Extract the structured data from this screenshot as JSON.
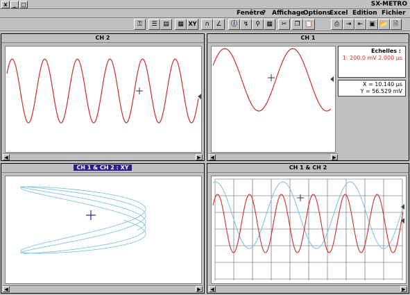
{
  "app": {
    "title": "SX-METRO",
    "sys_close": "x",
    "sys_min": "_",
    "sys_max": "□"
  },
  "menu": {
    "items": [
      "Fichier",
      "Edition",
      "Excel",
      "Options",
      "Affichage",
      "Fenêtre",
      "?"
    ]
  },
  "toolbar": {
    "xy_label": "XY"
  },
  "panels": {
    "ch2": {
      "title": "CH 2"
    },
    "ch1": {
      "title": "CH 1",
      "scales_title": "Echelles :",
      "scales_value": "1:  200.0 mV   2.000 µs",
      "x_readout": "X  = 10.140 µs",
      "y_readout": "Y  = 56.529 mV"
    },
    "xy": {
      "title": "CH 1 & CH 2 : XY"
    },
    "ch12": {
      "title": "CH 1 & CH 2"
    }
  },
  "colors": {
    "ch1": "#cc2a2a",
    "ch2": "#7fc4e0",
    "active_title": "#2a1e8a"
  }
}
